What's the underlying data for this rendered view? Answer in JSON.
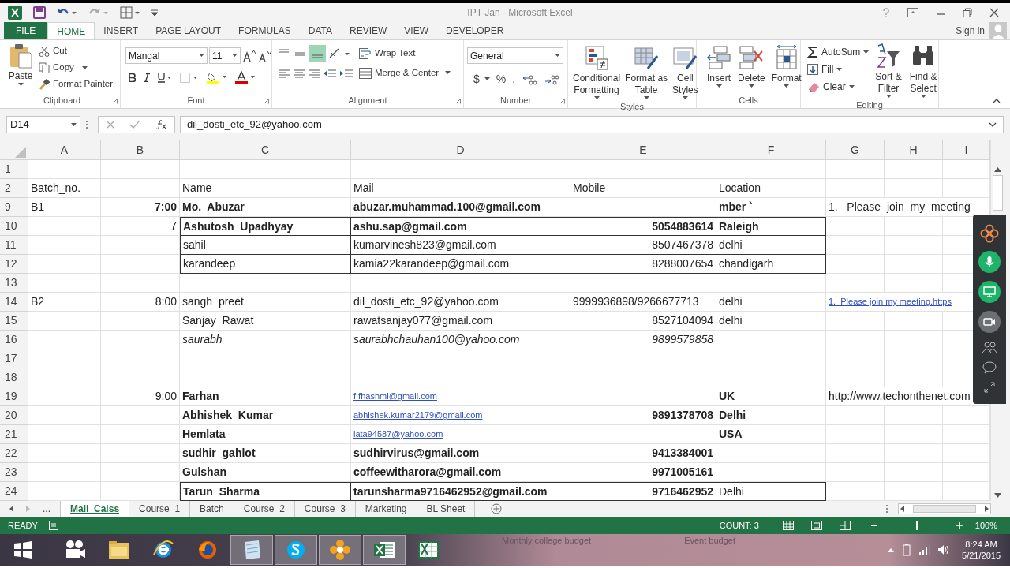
{
  "window": {
    "title": "IPT-Jan - Microsoft Excel"
  },
  "ribbon": {
    "tabs": [
      {
        "label": "FILE",
        "kind": "file",
        "selected": false
      },
      {
        "label": "HOME",
        "kind": "tab",
        "selected": true
      },
      {
        "label": "INSERT",
        "kind": "tab",
        "selected": false
      },
      {
        "label": "PAGE LAYOUT",
        "kind": "tab",
        "selected": false
      },
      {
        "label": "FORMULAS",
        "kind": "tab",
        "selected": false
      },
      {
        "label": "DATA",
        "kind": "tab",
        "selected": false
      },
      {
        "label": "REVIEW",
        "kind": "tab",
        "selected": false
      },
      {
        "label": "VIEW",
        "kind": "tab",
        "selected": false
      },
      {
        "label": "DEVELOPER",
        "kind": "tab",
        "selected": false
      }
    ],
    "sign_in": "Sign in",
    "groups": [
      {
        "kind": "clipboard",
        "label": "Clipboard",
        "paste": "Paste",
        "cut": "Cut",
        "copy": "Copy",
        "painter": "Format Painter"
      },
      {
        "kind": "font",
        "label": "Font",
        "font": "Mangal",
        "size": "11"
      },
      {
        "kind": "alignment",
        "label": "Alignment",
        "wrap": "Wrap Text",
        "merge": "Merge & Center"
      },
      {
        "kind": "number",
        "label": "Number",
        "format": "General",
        "symbols": [
          "$",
          "%",
          ","
        ]
      },
      {
        "kind": "styles",
        "label": "Styles",
        "buttons": [
          {
            "lines": [
              "Conditional",
              "Formatting"
            ]
          },
          {
            "lines": [
              "Format as",
              "Table"
            ]
          },
          {
            "lines": [
              "Cell",
              "Styles"
            ]
          }
        ]
      },
      {
        "kind": "cells",
        "label": "Cells",
        "buttons": [
          {
            "lines": [
              "Insert"
            ]
          },
          {
            "lines": [
              "Delete"
            ]
          },
          {
            "lines": [
              "Format"
            ]
          }
        ]
      },
      {
        "kind": "editing",
        "label": "Editing",
        "autosum": "AutoSum",
        "fill": "Fill",
        "clear": "Clear",
        "buttons": [
          {
            "lines": [
              "Sort &",
              "Filter"
            ]
          },
          {
            "lines": [
              "Find &",
              "Select"
            ]
          }
        ]
      }
    ]
  },
  "formula_bar": {
    "name_box": "D14",
    "formula": "dil_dosti_etc_92@yahoo.com"
  },
  "sheet": {
    "columns": [
      "A",
      "B",
      "C",
      "D",
      "E",
      "F",
      "G",
      "H",
      "I"
    ],
    "rows": [
      {
        "number": "1",
        "boxed": false,
        "cells": [
          null,
          null,
          null,
          null,
          null,
          null,
          null,
          null,
          null
        ]
      },
      {
        "number": "2",
        "boxed": false,
        "cells": [
          {
            "text": "Batch_no.",
            "kind": "plain",
            "align_right": false
          },
          null,
          {
            "text": "Name",
            "kind": "plain",
            "align_right": false
          },
          {
            "text": "Mail",
            "kind": "plain",
            "align_right": false
          },
          {
            "text": "Mobile",
            "kind": "plain",
            "align_right": false
          },
          {
            "text": "Location",
            "kind": "plain",
            "align_right": false
          },
          null,
          null,
          null
        ]
      },
      {
        "number": "9",
        "boxed": false,
        "cells": [
          {
            "text": "B1",
            "kind": "plain",
            "align_right": false
          },
          {
            "text": "7:00",
            "kind": "bold",
            "align_right": true
          },
          {
            "text": "Mo.  Abuzar",
            "kind": "bold",
            "align_right": false
          },
          {
            "text": "abuzar.muhammad.100@gmail.com",
            "kind": "bold",
            "align_right": false
          },
          null,
          {
            "text": "mber `",
            "kind": "bold",
            "align_right": false
          },
          {
            "text": "1.   Please  join  my  meeting",
            "kind": "plain",
            "align_right": false
          },
          null,
          null
        ]
      },
      {
        "number": "10",
        "boxed": true,
        "cells": [
          null,
          {
            "text": "7",
            "kind": "plain",
            "align_right": true
          },
          {
            "text": "Ashutosh  Upadhyay",
            "kind": "bold",
            "align_right": false
          },
          {
            "text": "ashu.sap@gmail.com",
            "kind": "bold",
            "align_right": false
          },
          {
            "text": "5054883614",
            "kind": "bold",
            "align_right": true
          },
          {
            "text": "Raleigh",
            "kind": "bold",
            "align_right": false
          },
          null,
          null,
          null
        ]
      },
      {
        "number": "11",
        "boxed": true,
        "cells": [
          null,
          null,
          {
            "text": "sahil",
            "kind": "plain",
            "align_right": false
          },
          {
            "text": "kumarvinesh823@gmail.com",
            "kind": "plain",
            "align_right": false
          },
          {
            "text": "8507467378",
            "kind": "plain",
            "align_right": true
          },
          {
            "text": "delhi",
            "kind": "plain",
            "align_right": false
          },
          null,
          null,
          null
        ]
      },
      {
        "number": "12",
        "boxed": true,
        "cells": [
          null,
          null,
          {
            "text": "karandeep",
            "kind": "plain",
            "align_right": false
          },
          {
            "text": "kamia22karandeep@gmail.com",
            "kind": "plain",
            "align_right": false
          },
          {
            "text": "8288007654",
            "kind": "plain",
            "align_right": true
          },
          {
            "text": "chandigarh",
            "kind": "plain",
            "align_right": false
          },
          null,
          null,
          null
        ]
      },
      {
        "number": "13",
        "boxed": false,
        "cells": [
          null,
          null,
          null,
          null,
          null,
          null,
          null,
          null,
          null
        ]
      },
      {
        "number": "14",
        "boxed": false,
        "cells": [
          {
            "text": "B2",
            "kind": "plain",
            "align_right": false
          },
          {
            "text": "8:00",
            "kind": "plain",
            "align_right": true
          },
          {
            "text": "sangh  preet",
            "kind": "plain",
            "align_right": false
          },
          {
            "text": "dil_dosti_etc_92@yahoo.com",
            "kind": "plain",
            "align_right": false
          },
          {
            "text": "9999936898/9266677713",
            "kind": "plain",
            "align_right": false
          },
          {
            "text": "delhi",
            "kind": "plain",
            "align_right": false
          },
          {
            "text": "1.  Please join my meeting.https",
            "kind": "link",
            "align_right": false
          },
          null,
          null
        ]
      },
      {
        "number": "15",
        "boxed": false,
        "cells": [
          null,
          null,
          {
            "text": "Sanjay  Rawat",
            "kind": "plain",
            "align_right": false
          },
          {
            "text": "rawatsanjay077@gmail.com",
            "kind": "plain",
            "align_right": false
          },
          {
            "text": "8527104094",
            "kind": "plain",
            "align_right": true
          },
          {
            "text": "delhi",
            "kind": "plain",
            "align_right": false
          },
          null,
          null,
          null
        ]
      },
      {
        "number": "16",
        "boxed": false,
        "cells": [
          null,
          null,
          {
            "text": "saurabh",
            "kind": "italic",
            "align_right": false
          },
          {
            "text": "saurabhchauhan100@yahoo.com",
            "kind": "italic",
            "align_right": false
          },
          {
            "text": "9899579858",
            "kind": "italic",
            "align_right": true
          },
          null,
          null,
          null,
          null
        ]
      },
      {
        "number": "17",
        "boxed": false,
        "cells": [
          null,
          null,
          null,
          null,
          null,
          null,
          null,
          null,
          null
        ]
      },
      {
        "number": "18",
        "boxed": false,
        "cells": [
          null,
          null,
          null,
          null,
          null,
          null,
          null,
          null,
          null
        ]
      },
      {
        "number": "19",
        "boxed": false,
        "cells": [
          null,
          {
            "text": "9:00",
            "kind": "plain",
            "align_right": true
          },
          {
            "text": "Farhan",
            "kind": "bold",
            "align_right": false
          },
          {
            "text": "f.fhashmi@gmail.com",
            "kind": "link",
            "align_right": false
          },
          null,
          {
            "text": "UK",
            "kind": "bold",
            "align_right": false
          },
          {
            "text": "http://www.techonthenet.com",
            "kind": "plain",
            "align_right": false
          },
          null,
          null
        ]
      },
      {
        "number": "20",
        "boxed": false,
        "cells": [
          null,
          null,
          {
            "text": "Abhishek  Kumar",
            "kind": "bold",
            "align_right": false
          },
          {
            "text": "abhishek.kumar2179@gmail.com",
            "kind": "link",
            "align_right": false
          },
          {
            "text": "9891378708",
            "kind": "bold",
            "align_right": true
          },
          {
            "text": "Delhi",
            "kind": "bold",
            "align_right": false
          },
          null,
          null,
          null
        ]
      },
      {
        "number": "21",
        "boxed": false,
        "cells": [
          null,
          null,
          {
            "text": "Hemlata",
            "kind": "bold",
            "align_right": false
          },
          {
            "text": "lata94587@yahoo.com",
            "kind": "link",
            "align_right": false
          },
          null,
          {
            "text": "USA",
            "kind": "bold",
            "align_right": false
          },
          null,
          null,
          null
        ]
      },
      {
        "number": "22",
        "boxed": false,
        "cells": [
          null,
          null,
          {
            "text": "sudhir  gahlot",
            "kind": "bold",
            "align_right": false
          },
          {
            "text": "sudhirvirus@gmail.com",
            "kind": "bold",
            "align_right": false
          },
          {
            "text": "9413384001",
            "kind": "bold",
            "align_right": true
          },
          null,
          null,
          null,
          null
        ]
      },
      {
        "number": "23",
        "boxed": false,
        "cells": [
          null,
          null,
          {
            "text": "Gulshan",
            "kind": "bold",
            "align_right": false
          },
          {
            "text": "coffeewitharora@gmail.com",
            "kind": "bold",
            "align_right": false
          },
          {
            "text": "9971005161",
            "kind": "bold",
            "align_right": true
          },
          null,
          null,
          null,
          null
        ]
      },
      {
        "number": "24",
        "boxed": true,
        "cells": [
          null,
          null,
          {
            "text": "Tarun  Sharma",
            "kind": "bold",
            "align_right": false
          },
          {
            "text": "tarunsharma9716462952@gmail.com",
            "kind": "bold",
            "align_right": false
          },
          {
            "text": "9716462952",
            "kind": "bold",
            "align_right": true
          },
          {
            "text": "Delhi",
            "kind": "plain",
            "align_right": false
          },
          null,
          null,
          null
        ]
      }
    ]
  },
  "sheet_tabs": {
    "more": "...",
    "tabs": [
      {
        "label": "Mail_Calss",
        "selected": true
      },
      {
        "label": "Course_1",
        "selected": false
      },
      {
        "label": "Batch",
        "selected": false
      },
      {
        "label": "Course_2",
        "selected": false
      },
      {
        "label": "Course_3",
        "selected": false
      },
      {
        "label": "Marketing",
        "selected": false
      },
      {
        "label": "BL Sheet",
        "selected": false
      }
    ]
  },
  "status_bar": {
    "mode": "READY",
    "count": "COUNT: 3",
    "zoom": {
      "level": 0.5
    },
    "zoom_text": "100%"
  },
  "taskbar": {
    "preview_texts": [
      "Monthly college budget",
      "Event budget"
    ],
    "time": "8:24 AM",
    "date": "5/21/2015"
  }
}
